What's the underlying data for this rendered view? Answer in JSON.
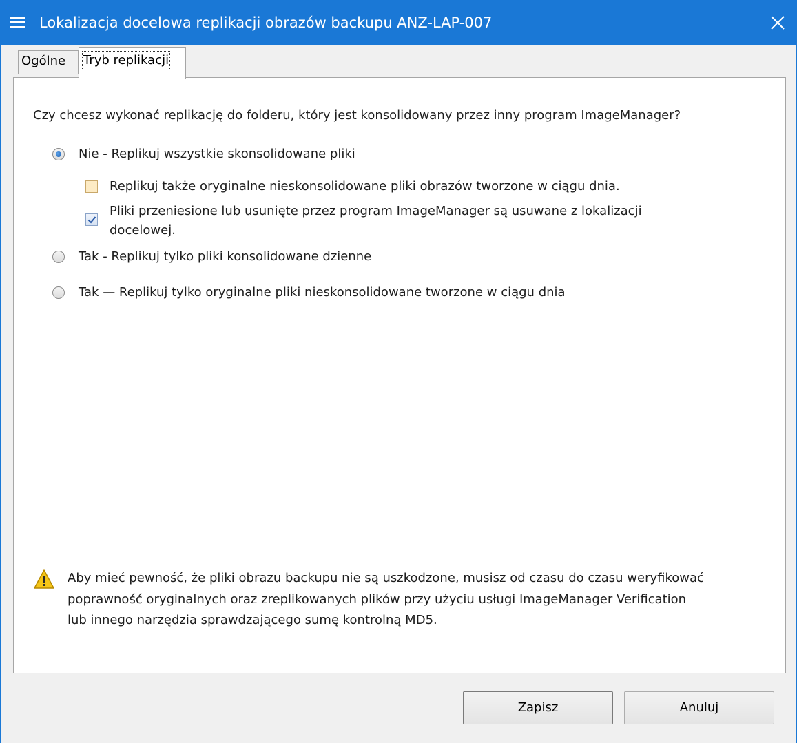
{
  "window": {
    "title": "Lokalizacja docelowa replikacji obrazów backupu ANZ-LAP-007",
    "accent_color": "#1a78d6"
  },
  "tabs": [
    {
      "label": "Ogólne",
      "active": false
    },
    {
      "label": "Tryb replikacji",
      "active": true
    }
  ],
  "question": "Czy chcesz wykonać replikację do folderu, który jest konsolidowany przez inny program ImageManager?",
  "options": {
    "no": {
      "label": "Nie - Replikuj wszystkie skonsolidowane pliki",
      "selected": true,
      "sub": {
        "replicate_originals": {
          "label": "Replikuj także oryginalne nieskonsolidowane pliki obrazów tworzone w ciągu dnia.",
          "checked": false
        },
        "delete_moved": {
          "label_line1": "Pliki przeniesione lub usunięte przez program ImageManager są usuwane z lokalizacji",
          "label_line2": "docelowej.",
          "checked": true
        }
      }
    },
    "yes_daily": {
      "label": "Tak - Replikuj tylko pliki konsolidowane dzienne",
      "selected": false
    },
    "yes_originals": {
      "label": "Tak — Replikuj tylko oryginalne pliki nieskonsolidowane tworzone w ciągu dnia",
      "selected": false
    }
  },
  "warning": {
    "icon": "warning-icon",
    "line1": "Aby mieć pewność, że pliki obrazu backupu nie są uszkodzone, musisz od czasu do czasu weryfikować",
    "line2": "poprawność oryginalnych oraz zreplikowanych plików przy użyciu usługi ImageManager Verification",
    "line3": "lub innego narzędzia sprawdzającego sumę kontrolną MD5."
  },
  "buttons": {
    "save": "Zapisz",
    "cancel": "Anuluj"
  }
}
